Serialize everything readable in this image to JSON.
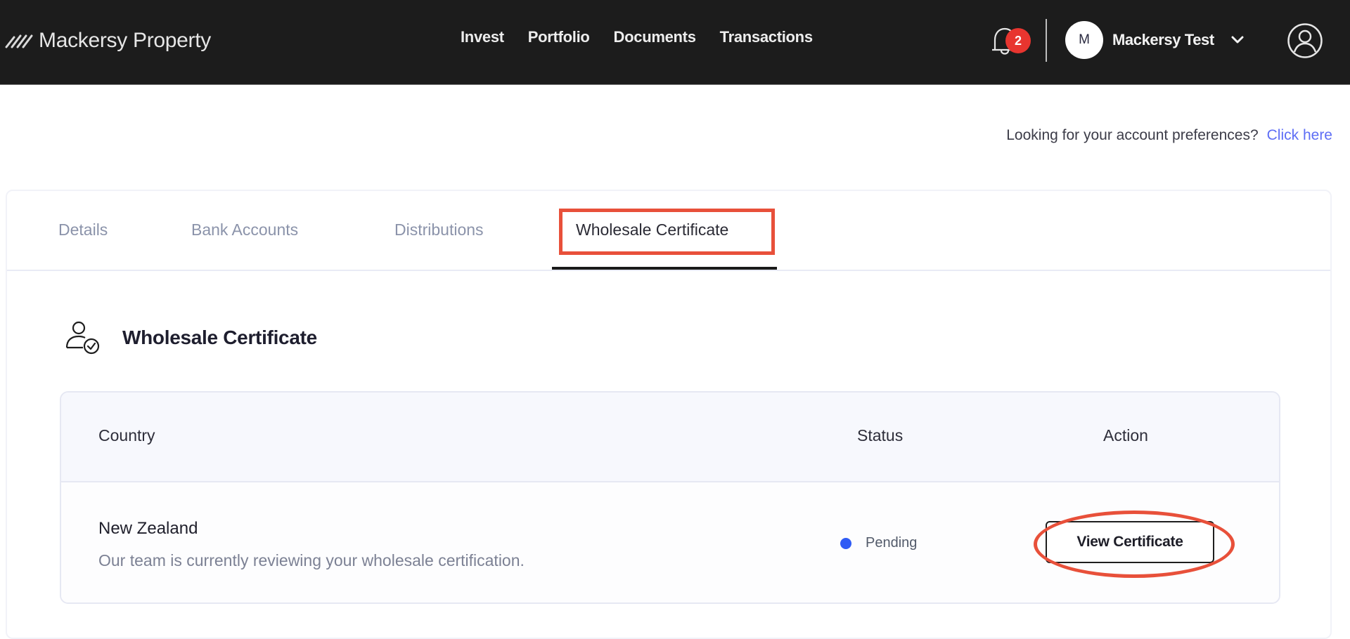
{
  "header": {
    "brand": "Mackersy Property",
    "nav": [
      {
        "label": "Invest"
      },
      {
        "label": "Portfolio"
      },
      {
        "label": "Documents"
      },
      {
        "label": "Transactions"
      }
    ],
    "notifications_count": "2",
    "user": {
      "initial": "M",
      "name": "Mackersy Test"
    }
  },
  "prefs": {
    "text": "Looking for your account preferences?",
    "link": "Click here"
  },
  "tabs": [
    {
      "label": "Details"
    },
    {
      "label": "Bank Accounts"
    },
    {
      "label": "Distributions"
    },
    {
      "label": "Wholesale Certificate",
      "active": true
    }
  ],
  "section": {
    "title": "Wholesale Certificate"
  },
  "table": {
    "columns": [
      "Country",
      "Status",
      "Action"
    ],
    "rows": [
      {
        "country": "New Zealand",
        "description": "Our team is currently reviewing your wholesale certification.",
        "status": "Pending",
        "status_color": "#2f5bf5",
        "action": "View Certificate"
      }
    ]
  },
  "colors": {
    "header_bg": "#1c1c1c",
    "link": "#5e6ef5",
    "badge": "#e8352f",
    "annotation": "#e8503a"
  }
}
